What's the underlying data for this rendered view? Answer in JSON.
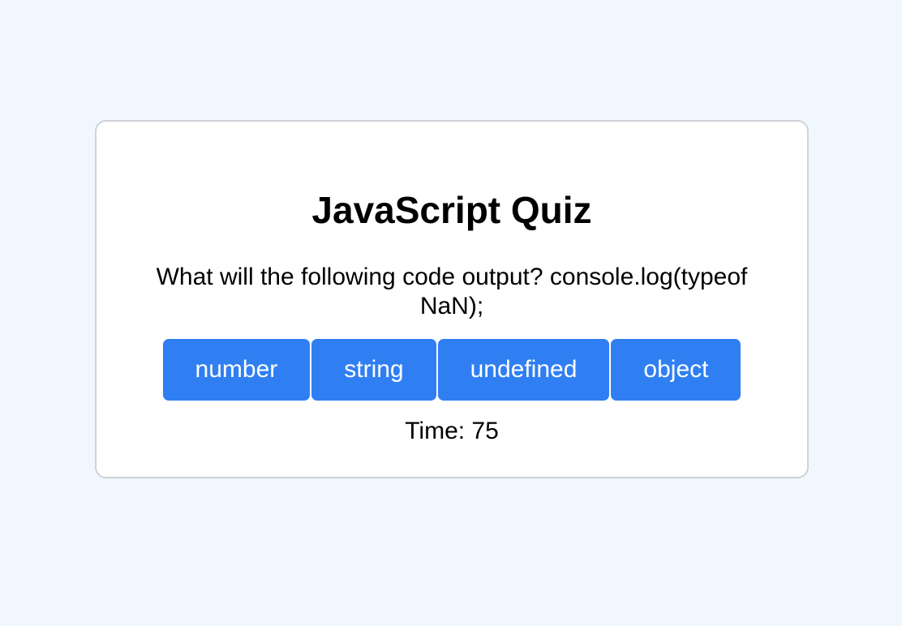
{
  "quiz": {
    "title": "JavaScript Quiz",
    "question": "What will the following code output? console.log(typeof NaN);",
    "answers": [
      "number",
      "string",
      "undefined",
      "object"
    ],
    "timer_text": "Time: 75"
  },
  "colors": {
    "page_background": "#f0f7ff",
    "card_background": "#ffffff",
    "card_border": "#cfd3d8",
    "button_background": "#2f7ff2",
    "button_text": "#ffffff"
  }
}
